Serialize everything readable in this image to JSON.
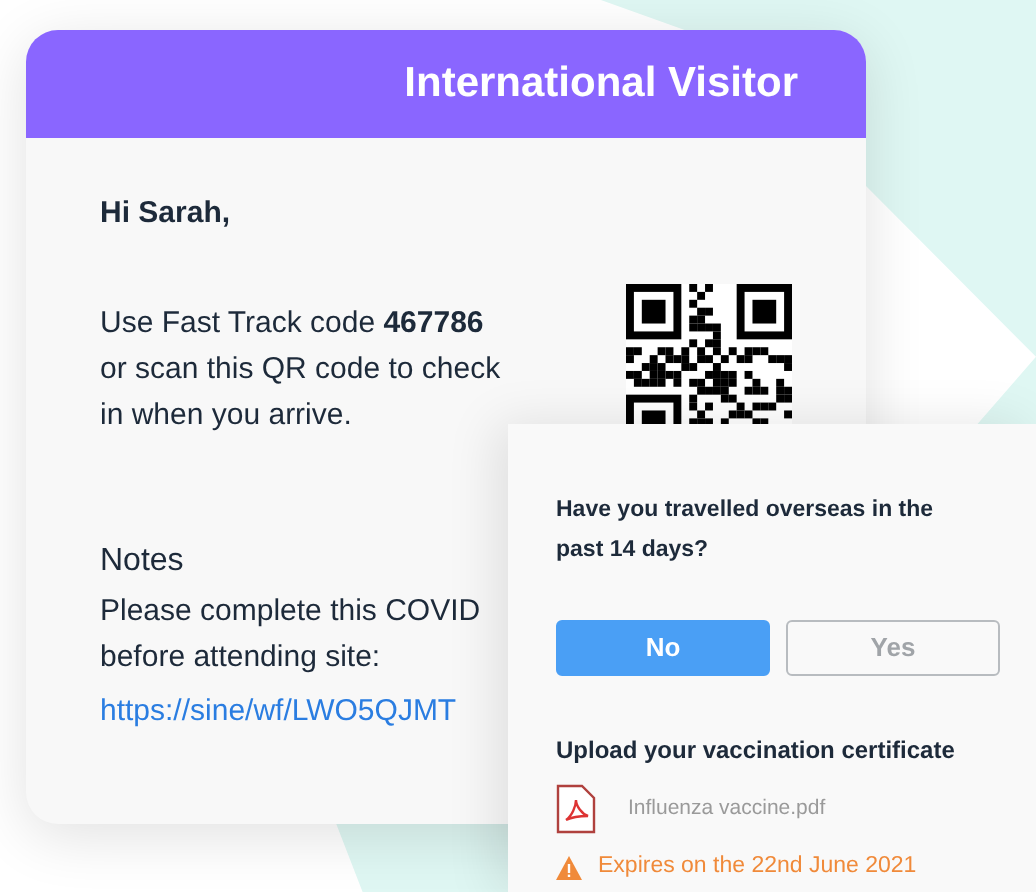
{
  "card": {
    "title": "International Visitor",
    "greeting": "Hi Sarah,",
    "message": "Use Fast Track code **467786**\nor scan this QR code to check\nin when you arrive.",
    "notes": {
      "heading": "Notes",
      "text": "Please complete this COVID\nbefore attending site:",
      "link": "https://sine/wf/LWO5QJMT"
    }
  },
  "overlay": {
    "question": "Have you travelled overseas in the past 14 days?",
    "options": [
      {
        "label": "No",
        "selected": true
      },
      {
        "label": "Yes",
        "selected": false
      }
    ],
    "upload_heading": "Upload your vaccination certificate",
    "file": {
      "name": "Influenza vaccine.pdf"
    },
    "warning": "Expires on the 22nd June 2021"
  }
}
